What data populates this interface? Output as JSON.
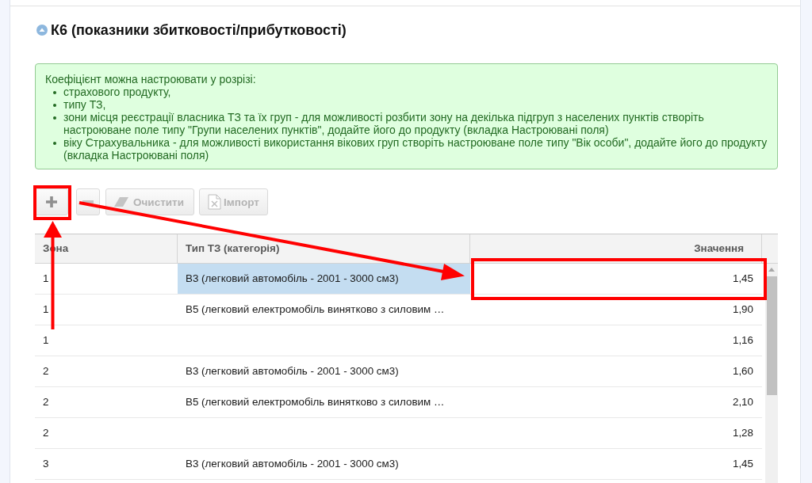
{
  "section": {
    "title": "К6 (показники збитковості/прибутковості)",
    "expanded": true
  },
  "info": {
    "intro": "Коефіцієнт можна настроювати у розрізі:",
    "items": [
      "страхового продукту,",
      "типу ТЗ,",
      "зони місця реєстрації власника ТЗ та їх груп - для можливості розбити зону на декілька підгруп з населених пунктів створіть настроюване поле типу \"Групи населених пунктів\", додайте його до продукту (вкладка Настроювані поля)",
      "віку Страхувальника - для можливості використання вікових груп створіть настроюване поле типу \"Вік особи\", додайте його до продукту (вкладка Настроювані поля)"
    ]
  },
  "toolbar": [
    {
      "kind": "add",
      "disabled": false
    },
    {
      "kind": "remove",
      "disabled": true
    },
    {
      "kind": "clear",
      "label": "Очистити",
      "disabled": true
    },
    {
      "kind": "import",
      "label": "Імпорт",
      "disabled": true
    }
  ],
  "table": {
    "columns": [
      "Зона",
      "Тип ТЗ (категорія)",
      "Значення"
    ],
    "rows": [
      {
        "zone": "1",
        "type": "В3 (легковий автомобіль - 2001 - 3000 см3)",
        "type_selected": true,
        "value": "1,45"
      },
      {
        "zone": "1",
        "type": "В5 (легковий електромобіль винятково з силовим …",
        "type_selected": false,
        "value": "1,90"
      },
      {
        "zone": "1",
        "type_selected": false,
        "value": "1,16"
      },
      {
        "zone": "2",
        "type": "В3 (легковий автомобіль - 2001 - 3000 см3)",
        "type_selected": false,
        "value": "1,60"
      },
      {
        "zone": "2",
        "type": "В5 (легковий електромобіль винятково з силовим …",
        "type_selected": false,
        "value": "2,10"
      },
      {
        "zone": "2",
        "type_selected": false,
        "value": "1,28"
      },
      {
        "zone": "3",
        "type": "В3 (легковий автомобіль - 2001 - 3000 см3)",
        "type_selected": false,
        "value": "1,45"
      }
    ]
  }
}
